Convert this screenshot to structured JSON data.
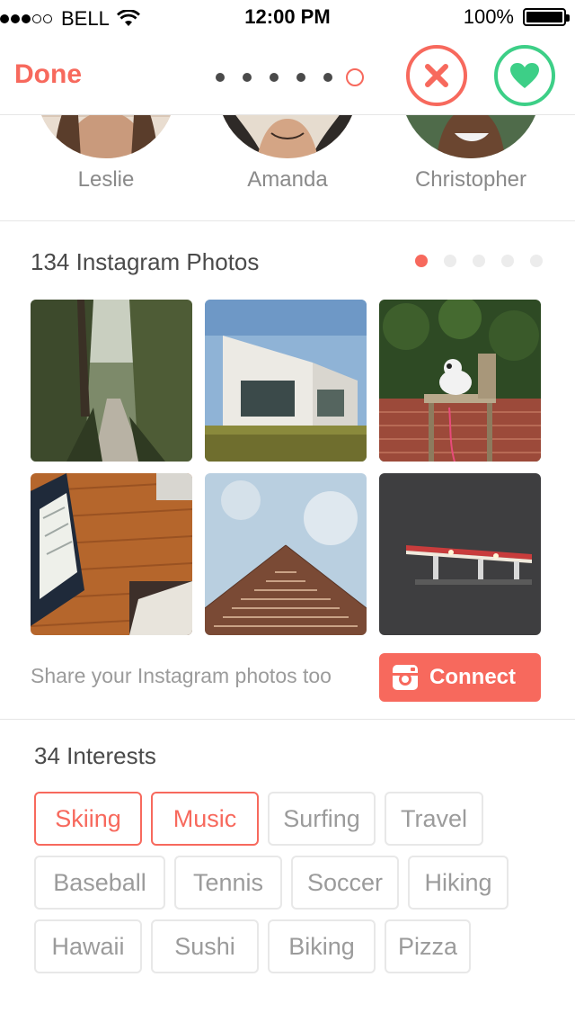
{
  "status_bar": {
    "carrier": "BELL",
    "time": "12:00 PM",
    "battery": "100%",
    "signal_bars_filled": 3,
    "signal_bars_total": 5
  },
  "nav": {
    "done_label": "Done",
    "page_count": 6,
    "current_page": 6,
    "nope_icon": "close-x-icon",
    "like_icon": "heart-icon"
  },
  "friends": [
    {
      "name": "Leslie"
    },
    {
      "name": "Amanda"
    },
    {
      "name": "Christopher"
    }
  ],
  "instagram": {
    "title": "134 Instagram Photos",
    "page_count": 5,
    "current_page": 1,
    "photos": [
      {
        "subject": "forest path"
      },
      {
        "subject": "modern house"
      },
      {
        "subject": "dog on chair"
      },
      {
        "subject": "wood floor interior"
      },
      {
        "subject": "tower from below"
      },
      {
        "subject": "gas station at night"
      }
    ],
    "share_text": "Share your Instagram photos too",
    "connect_label": "Connect"
  },
  "interests": {
    "title": "34 Interests",
    "items": [
      {
        "label": "Skiing",
        "selected": true
      },
      {
        "label": "Music",
        "selected": true
      },
      {
        "label": "Surfing",
        "selected": false
      },
      {
        "label": "Travel",
        "selected": false
      },
      {
        "label": "Baseball",
        "selected": false
      },
      {
        "label": "Tennis",
        "selected": false
      },
      {
        "label": "Soccer",
        "selected": false
      },
      {
        "label": "Hiking",
        "selected": false
      },
      {
        "label": "Hawaii",
        "selected": false
      },
      {
        "label": "Sushi",
        "selected": false
      },
      {
        "label": "Biking",
        "selected": false
      },
      {
        "label": "Pizza",
        "selected": false
      }
    ]
  },
  "colors": {
    "accent": "#f7695d",
    "like": "#3dcf87",
    "text": "#4a4a4a",
    "muted": "#9b9b9b"
  }
}
